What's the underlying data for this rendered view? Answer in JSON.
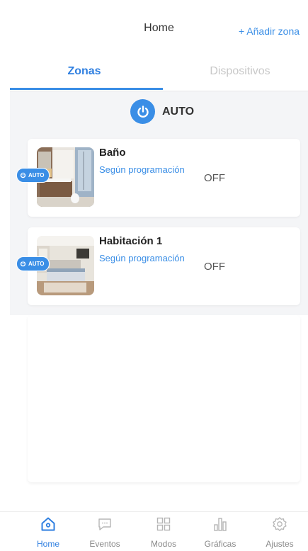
{
  "header": {
    "title": "Home",
    "add_zone_label": "+ Añadir zona"
  },
  "tabs": [
    {
      "label": "Zonas",
      "active": true
    },
    {
      "label": "Dispositivos",
      "active": false
    }
  ],
  "mode": {
    "label": "AUTO",
    "icon": "power-icon"
  },
  "zones": [
    {
      "name": "Baño",
      "schedule": "Según programación",
      "state": "OFF",
      "badge": "AUTO",
      "thumbnail": "bathroom-photo"
    },
    {
      "name": "Habitación 1",
      "schedule": "Según programación",
      "state": "OFF",
      "badge": "AUTO",
      "thumbnail": "bedroom-photo"
    }
  ],
  "bottom_nav": [
    {
      "label": "Home",
      "icon": "home-icon",
      "active": true
    },
    {
      "label": "Eventos",
      "icon": "chat-bubble-icon",
      "active": false
    },
    {
      "label": "Modos",
      "icon": "grid-icon",
      "active": false
    },
    {
      "label": "Gráficas",
      "icon": "bar-chart-icon",
      "active": false
    },
    {
      "label": "Ajustes",
      "icon": "gear-icon",
      "active": false
    }
  ],
  "colors": {
    "accent": "#3a8ee6",
    "background": "#f4f5f7",
    "inactive_tab": "#c8c8c8"
  }
}
